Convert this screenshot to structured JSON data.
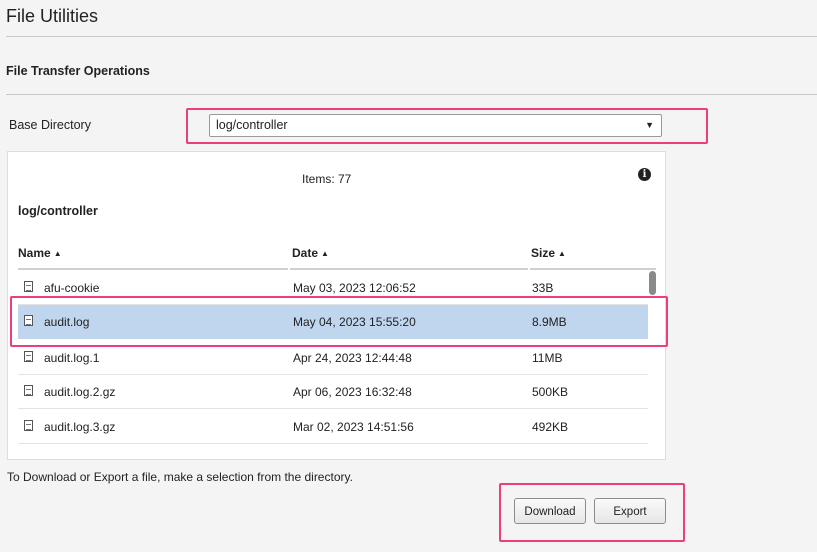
{
  "page": {
    "title": "File Utilities",
    "section_title": "File Transfer Operations"
  },
  "base_directory": {
    "label": "Base Directory",
    "selected": "log/controller"
  },
  "browser": {
    "items_count": "Items: 77",
    "path": "log/controller",
    "columns": {
      "name": "Name",
      "date": "Date",
      "size": "Size"
    },
    "rows": [
      {
        "name": "afu-cookie",
        "date": "May 03, 2023 12:06:52",
        "size": "33B",
        "selected": false
      },
      {
        "name": "audit.log",
        "date": "May 04, 2023 15:55:20",
        "size": "8.9MB",
        "selected": true
      },
      {
        "name": "audit.log.1",
        "date": "Apr 24, 2023 12:44:48",
        "size": "11MB",
        "selected": false
      },
      {
        "name": "audit.log.2.gz",
        "date": "Apr 06, 2023 16:32:48",
        "size": "500KB",
        "selected": false
      },
      {
        "name": "audit.log.3.gz",
        "date": "Mar 02, 2023 14:51:56",
        "size": "492KB",
        "selected": false
      }
    ]
  },
  "hint": "To Download or Export a file, make a selection from the directory.",
  "buttons": {
    "download": "Download",
    "export": "Export"
  },
  "colors": {
    "highlight": "#ee3d7c",
    "selected_row": "#c0d6ee"
  },
  "icons": {
    "info": "info-icon",
    "file": "file-icon",
    "sort": "sort-icon",
    "dropdown": "chevron-down-icon"
  }
}
